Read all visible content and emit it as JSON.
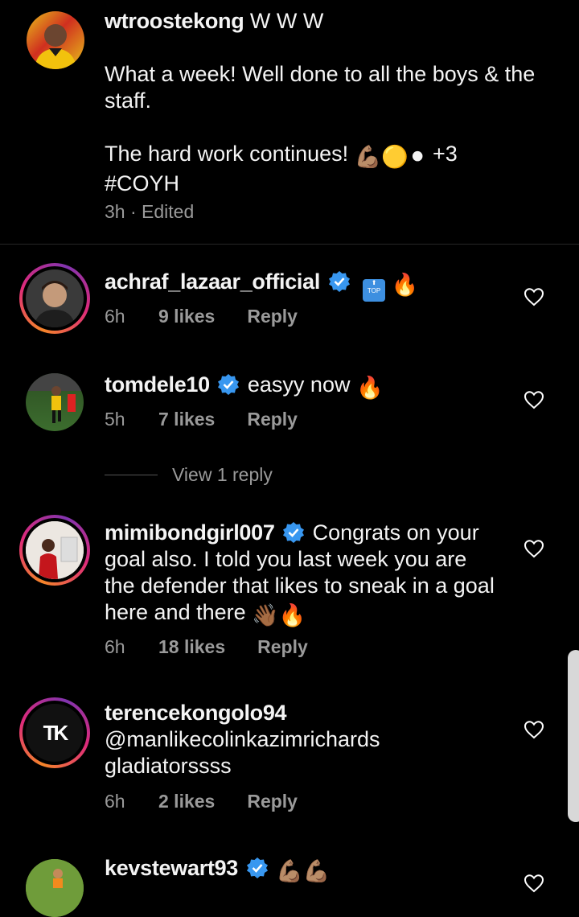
{
  "caption": {
    "username": "wtroostekong",
    "title_suffix": " W W W",
    "line1": "What a week! Well done to all the boys & the staff.",
    "line2_text": "The hard work continues! ",
    "line2_emoji": "💪🏽🟡⚫",
    "line2_more": " +3",
    "line3": "#COYH",
    "time": "3h",
    "edited": " · Edited"
  },
  "comments": [
    {
      "username": "achraf_lazaar_official",
      "verified": true,
      "text": "",
      "emoji": "🔥",
      "top_label": "TOP",
      "time": "6h",
      "likes": "9 likes",
      "reply": "Reply"
    },
    {
      "username": "tomdele10",
      "verified": true,
      "text": "easyy now ",
      "emoji": "🔥",
      "time": "5h",
      "likes": "7 likes",
      "reply": "Reply"
    },
    {
      "username": "mimibondgirl007",
      "verified": true,
      "text": "Congrats on your goal also. I told you last week you are the defender that likes to sneak in a goal here and there ",
      "emoji": "👋🏾🔥",
      "time": "6h",
      "likes": "18 likes",
      "reply": "Reply"
    },
    {
      "username": "terencekongolo94",
      "verified": false,
      "text": "@manlikecolinkazimrichards gladiatorssss",
      "avatar_text": "TK",
      "time": "6h",
      "likes": "2 likes",
      "reply": "Reply"
    },
    {
      "username": "kevstewart93",
      "verified": true,
      "text": "",
      "emoji": "💪🏽💪🏽"
    }
  ],
  "view_replies": "View 1 reply",
  "icons": {
    "verified": "verified-badge-icon",
    "like": "heart-outline-icon"
  },
  "colors": {
    "background": "#000000",
    "text": "#f4f4f4",
    "muted": "#9a9a9a",
    "verified": "#3897f0"
  }
}
